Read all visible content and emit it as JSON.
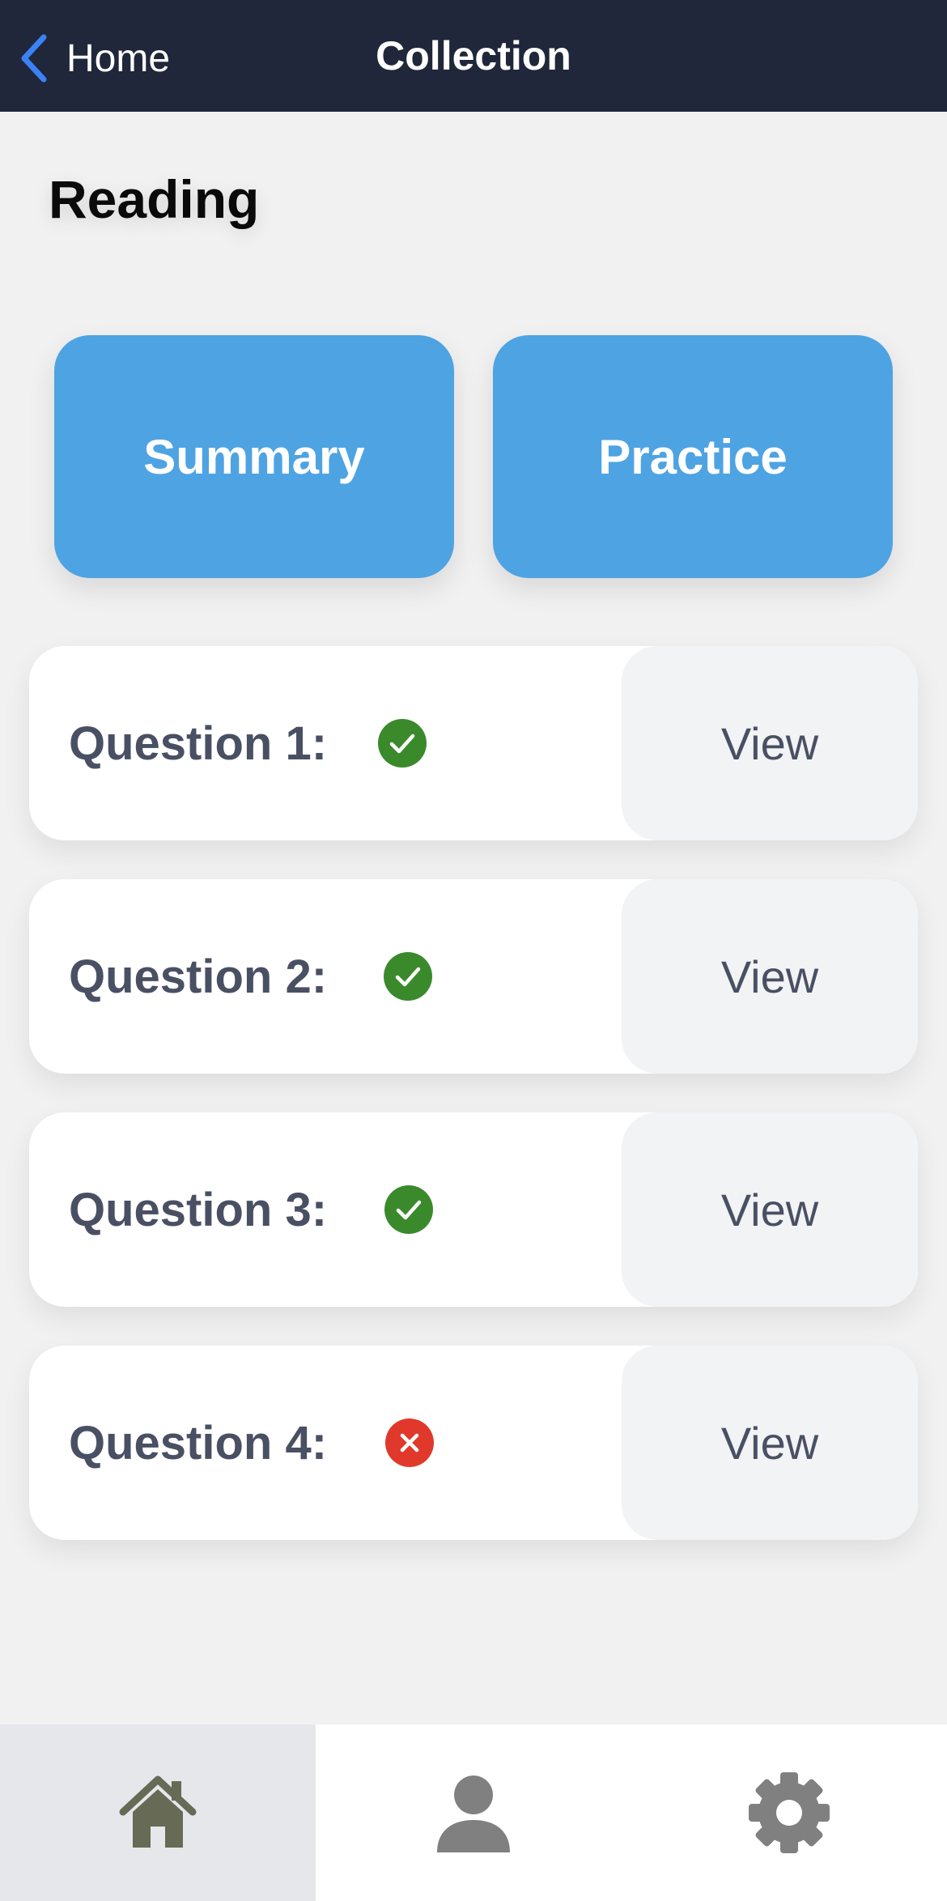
{
  "header": {
    "back_label": "Home",
    "title": "Collection"
  },
  "section": {
    "title": "Reading"
  },
  "actions": {
    "summary_label": "Summary",
    "practice_label": "Practice",
    "button_color": "#4ea3e2"
  },
  "questions": [
    {
      "label": "Question 1:",
      "status": "correct",
      "status_icon": "check-circle-icon",
      "view_label": "View"
    },
    {
      "label": "Question 2:",
      "status": "correct",
      "status_icon": "check-circle-icon",
      "view_label": "View"
    },
    {
      "label": "Question 3:",
      "status": "correct",
      "status_icon": "check-circle-icon",
      "view_label": "View"
    },
    {
      "label": "Question 4:",
      "status": "incorrect",
      "status_icon": "x-circle-icon",
      "view_label": "View"
    }
  ],
  "colors": {
    "header_bg": "#20273a",
    "back_arrow": "#3b82f6",
    "correct": "#3a8a2c",
    "incorrect": "#e0392b",
    "home_icon": "#676a54",
    "tab_icon": "#808080"
  },
  "tabbar": {
    "tabs": [
      {
        "icon": "home-icon",
        "active": true
      },
      {
        "icon": "person-icon",
        "active": false
      },
      {
        "icon": "gear-icon",
        "active": false
      }
    ]
  }
}
